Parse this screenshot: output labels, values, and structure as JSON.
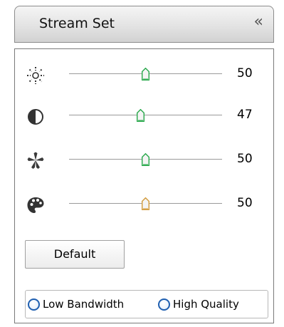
{
  "panel": {
    "title": "Stream Set",
    "collapse_glyph": "«"
  },
  "sliders": [
    {
      "name": "brightness",
      "icon": "brightness-icon",
      "value": 50,
      "min": 0,
      "max": 100,
      "thumb_color": "#27a84a"
    },
    {
      "name": "contrast",
      "icon": "contrast-icon",
      "value": 47,
      "min": 0,
      "max": 100,
      "thumb_color": "#27a84a"
    },
    {
      "name": "saturation",
      "icon": "saturation-icon",
      "value": 50,
      "min": 0,
      "max": 100,
      "thumb_color": "#27a84a"
    },
    {
      "name": "hue",
      "icon": "hue-icon",
      "value": 50,
      "min": 0,
      "max": 100,
      "thumb_color": "#d29a3a"
    }
  ],
  "buttons": {
    "default_label": "Default"
  },
  "quality": {
    "options": [
      "Low Bandwidth",
      "High Quality"
    ]
  },
  "colors": {
    "radio_border": "#1f5fb0",
    "panel_border": "#7a7a7a"
  }
}
